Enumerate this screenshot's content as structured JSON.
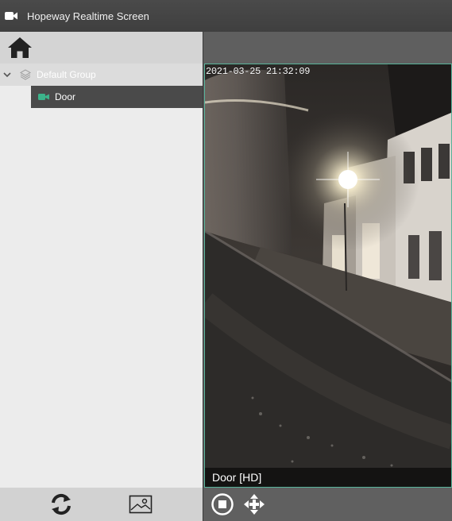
{
  "window": {
    "title": "Hopeway Realtime Screen",
    "icon": "video-camera-icon"
  },
  "sidebar": {
    "home_icon": "home-icon",
    "tree": {
      "group": {
        "label": "Default Group",
        "icon": "layers-icon",
        "expanded": true,
        "items": [
          {
            "label": "Door",
            "icon": "camera-icon",
            "selected": true
          }
        ]
      }
    },
    "toolbar": {
      "refresh_icon": "refresh-icon",
      "snapshot_icon": "image-frame-icon"
    }
  },
  "player": {
    "timestamp": "2021-03-25 21:32:09",
    "caption": "Door [HD]",
    "border_color": "#58b39a",
    "toolbar": {
      "stop_icon": "stop-circle-icon",
      "ptz_icon": "move-arrows-icon"
    }
  },
  "colors": {
    "accent": "#3cb38a",
    "titlebar": "#454545",
    "sidebar": "#ececec",
    "selected_item": "#4a4a4a"
  }
}
